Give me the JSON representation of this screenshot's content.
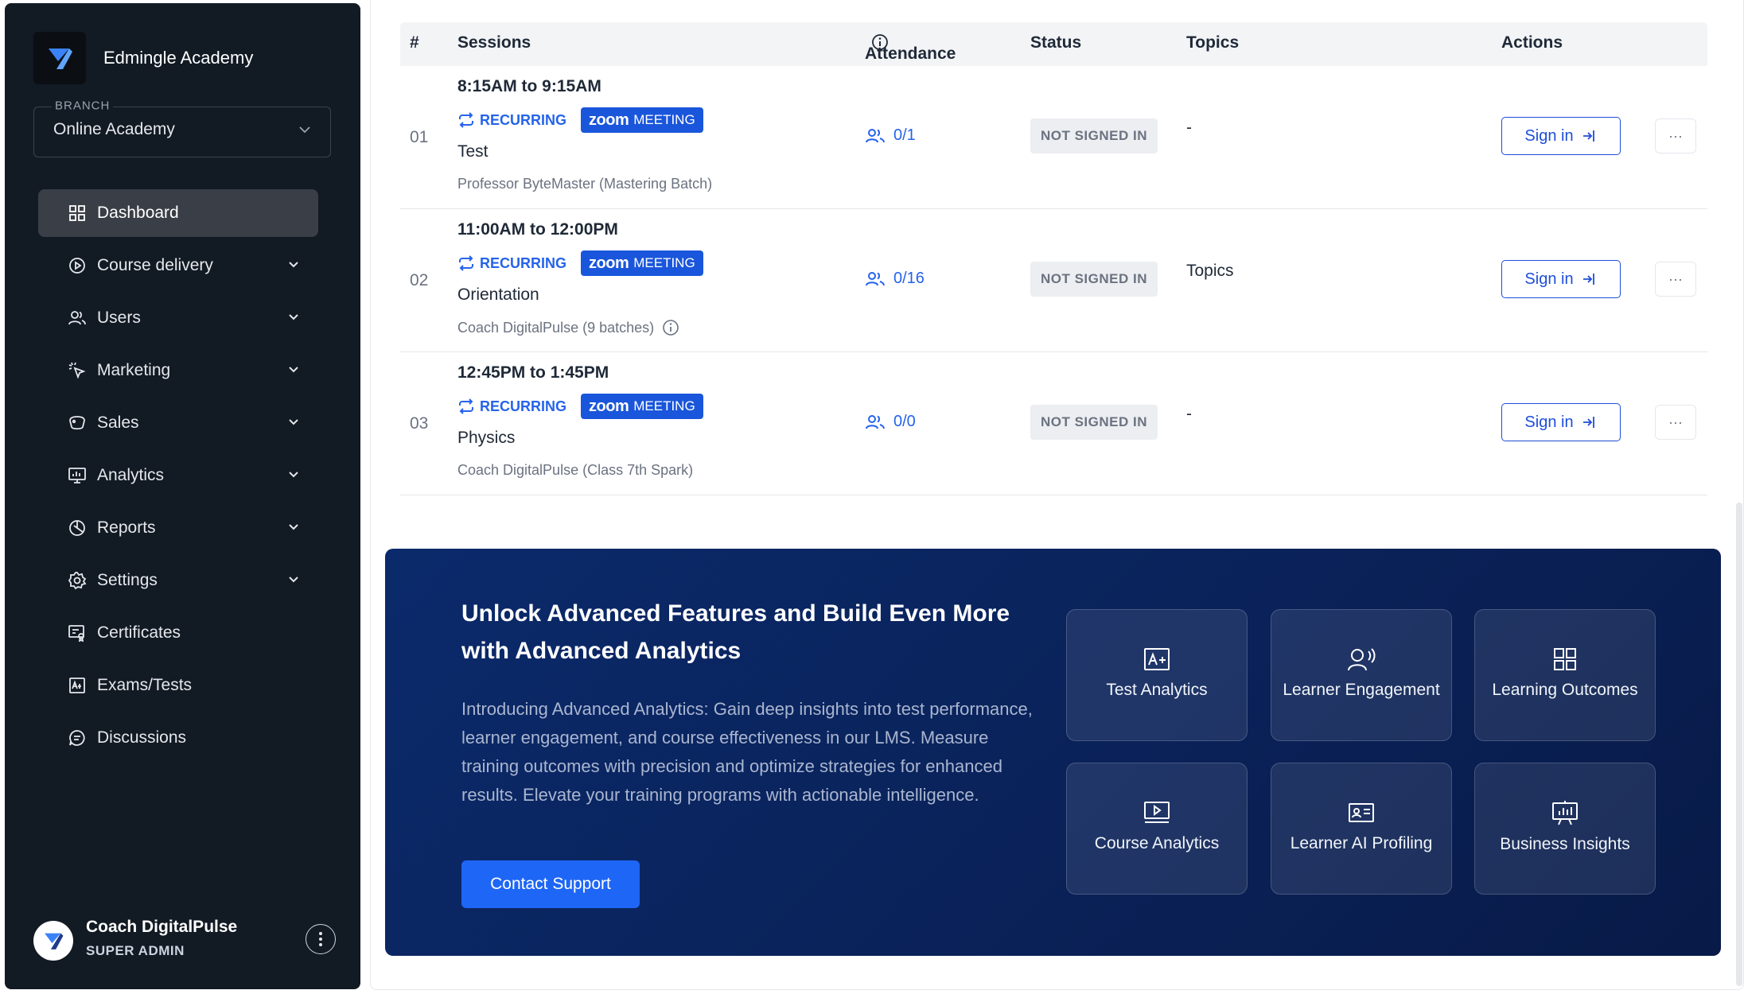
{
  "sidebar": {
    "brand_name": "Edmingle Academy",
    "branch_label": "BRANCH",
    "branch_value": "Online Academy",
    "items": [
      {
        "label": "Dashboard",
        "active": true
      },
      {
        "label": "Course delivery"
      },
      {
        "label": "Users"
      },
      {
        "label": "Marketing"
      },
      {
        "label": "Sales"
      },
      {
        "label": "Analytics"
      },
      {
        "label": "Reports"
      },
      {
        "label": "Settings"
      },
      {
        "label": "Certificates"
      },
      {
        "label": "Exams/Tests"
      },
      {
        "label": "Discussions"
      }
    ],
    "user": {
      "name": "Coach DigitalPulse",
      "role": "SUPER ADMIN"
    }
  },
  "table": {
    "headers": {
      "num": "#",
      "sessions": "Sessions",
      "attendance": "Attendance",
      "status": "Status",
      "topics": "Topics",
      "actions": "Actions"
    },
    "rows": [
      {
        "num": "01",
        "time": "8:15AM to 9:15AM",
        "recurring": "RECURRING",
        "zoom_logo": "zoom",
        "zoom_label": "MEETING",
        "name": "Test",
        "teacher": "Professor ByteMaster (Mastering Batch)",
        "attendance": "0/1",
        "status": "NOT SIGNED IN",
        "topics": "-",
        "action": "Sign in",
        "more": "···"
      },
      {
        "num": "02",
        "time": "11:00AM to 12:00PM",
        "recurring": "RECURRING",
        "zoom_logo": "zoom",
        "zoom_label": "MEETING",
        "name": "Orientation",
        "teacher": "Coach DigitalPulse (9 batches)",
        "attendance": "0/16",
        "status": "NOT SIGNED IN",
        "topics": "Topics",
        "action": "Sign in",
        "more": "···"
      },
      {
        "num": "03",
        "time": "12:45PM to 1:45PM",
        "recurring": "RECURRING",
        "zoom_logo": "zoom",
        "zoom_label": "MEETING",
        "name": "Physics",
        "teacher": "Coach DigitalPulse (Class 7th Spark)",
        "attendance": "0/0",
        "status": "NOT SIGNED IN",
        "topics": "-",
        "action": "Sign in",
        "more": "···"
      }
    ]
  },
  "promo": {
    "title": "Unlock Advanced Features and Build Even More with Advanced Analytics",
    "description": "Introducing Advanced Analytics: Gain deep insights into test performance, learner engagement, and course effectiveness in our LMS. Measure training outcomes with precision and optimize strategies for enhanced results. Elevate your training programs with actionable intelligence.",
    "button": "Contact Support",
    "tiles": [
      {
        "label": "Test Analytics",
        "icon": "grade-icon"
      },
      {
        "label": "Learner Engagement",
        "icon": "speaking-user-icon"
      },
      {
        "label": "Learning Outcomes",
        "icon": "grid-icon"
      },
      {
        "label": "Course Analytics",
        "icon": "video-icon"
      },
      {
        "label": "Learner AI Profiling",
        "icon": "id-card-icon"
      },
      {
        "label": "Business Insights",
        "icon": "presentation-icon"
      }
    ]
  },
  "colors": {
    "sidebar_bg": "#121a24",
    "accent": "#1d4ed8",
    "zoom": "#1a56db",
    "promo_bg": "#0b2a6b"
  }
}
